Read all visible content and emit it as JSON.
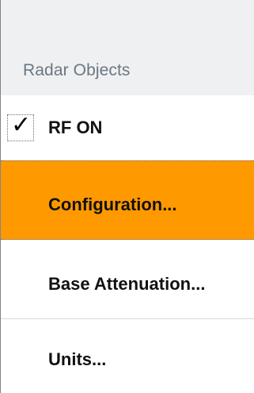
{
  "menu": {
    "header_title": "Radar Objects",
    "items": [
      {
        "label": "RF ON",
        "checked": true,
        "check_icon": "check-icon"
      },
      {
        "label": "Configuration...",
        "highlighted": true
      },
      {
        "label": "Base Attenuation..."
      },
      {
        "label": "Units..."
      }
    ],
    "colors": {
      "highlight": "#ff9900",
      "header_bg": "#eef0f2",
      "header_text": "#6b7782",
      "item_text": "#111111"
    }
  }
}
